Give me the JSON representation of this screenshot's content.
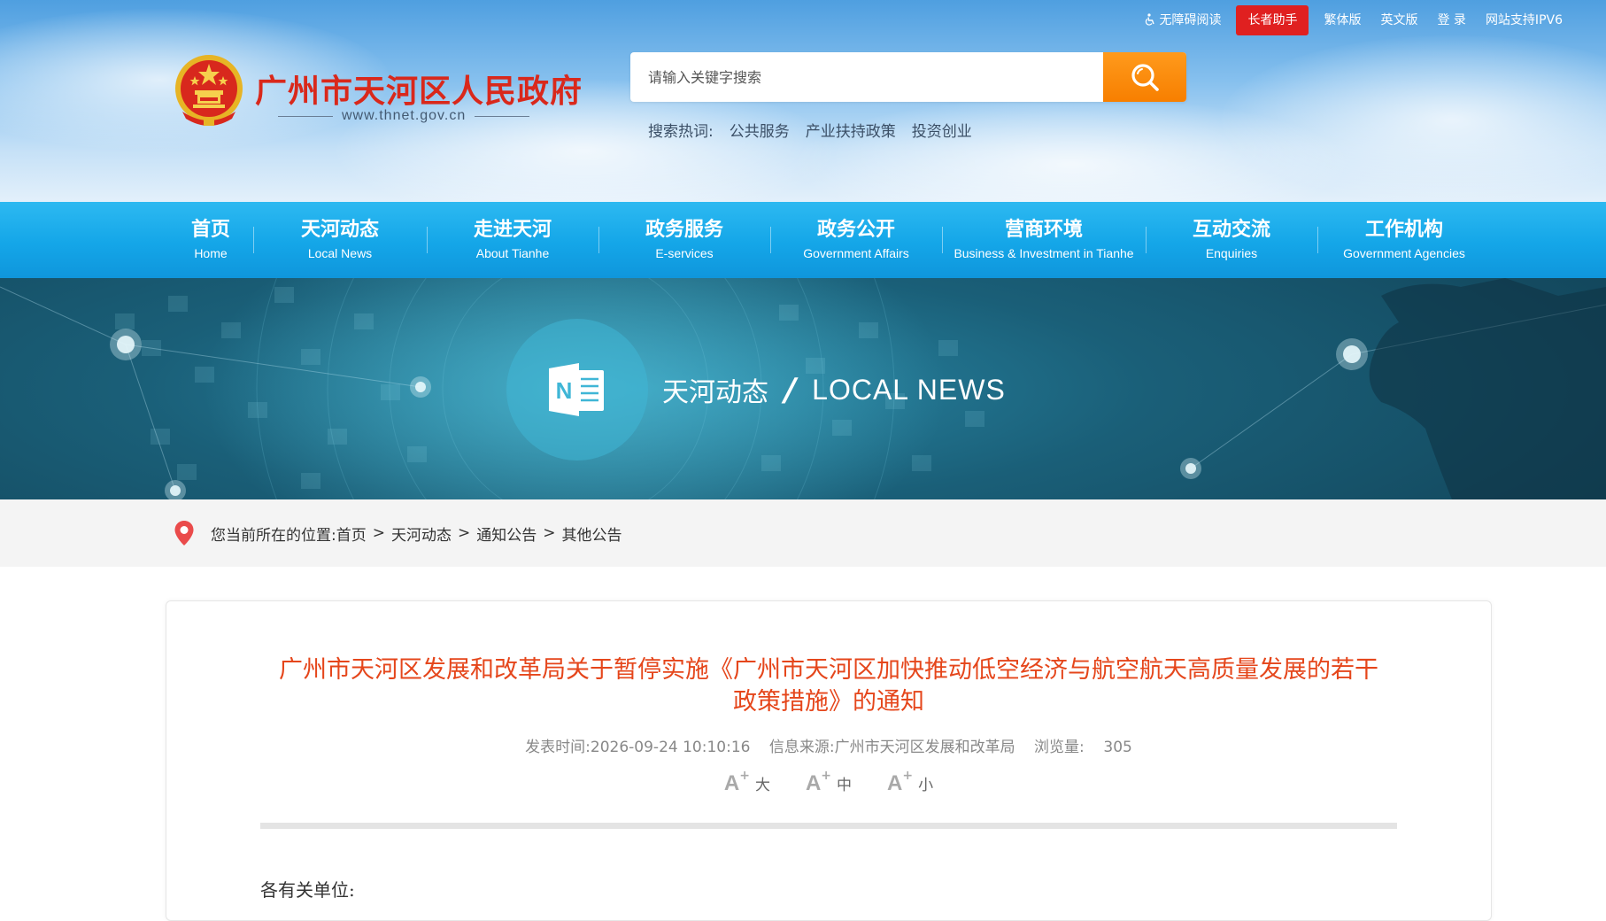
{
  "top_links": {
    "accessibility": "无障碍阅读",
    "elder": "长者助手",
    "traditional": "繁体版",
    "english": "英文版",
    "login": "登 录",
    "ipv6": "网站支持IPV6"
  },
  "site": {
    "name": "广州市天河区人民政府",
    "domain": "www.thnet.gov.cn"
  },
  "search": {
    "placeholder": "请输入关键字搜索",
    "hot_label": "搜索热词:",
    "hot_words": [
      "公共服务",
      "产业扶持政策",
      "投资创业"
    ]
  },
  "nav": [
    {
      "cn": "首页",
      "en": "Home"
    },
    {
      "cn": "天河动态",
      "en": "Local News"
    },
    {
      "cn": "走进天河",
      "en": "About Tianhe"
    },
    {
      "cn": "政务服务",
      "en": "E-services"
    },
    {
      "cn": "政务公开",
      "en": "Government Affairs"
    },
    {
      "cn": "营商环境",
      "en": "Business & Investment in Tianhe"
    },
    {
      "cn": "互动交流",
      "en": "Enquiries"
    },
    {
      "cn": "工作机构",
      "en": "Government Agencies"
    }
  ],
  "banner": {
    "cn": "天河动态",
    "slash": "/",
    "en": "LOCAL NEWS",
    "icon_letter": "N"
  },
  "breadcrumb": {
    "label": "您当前所在的位置:",
    "items": [
      "首页",
      "天河动态",
      "通知公告",
      "其他公告"
    ],
    "separator": ">"
  },
  "article": {
    "title_line1": "广州市天河区发展和改革局关于暂停实施《广州市天河区加快推动低空经济与航空航天高质量发展的若干",
    "title_line2": "政策措施》的通知",
    "publish_label": "发表时间:",
    "publish_time": "2026-09-24 10:10:16",
    "source_label": "信息来源:",
    "source": "广州市天河区发展和改革局",
    "views_label": "浏览量:",
    "views": "305",
    "font_sizes": {
      "a": "A",
      "plus": "+",
      "large": "大",
      "medium": "中",
      "small": "小"
    },
    "salutation": "各有关单位:"
  },
  "colors": {
    "nav_blue": "#14a6e8",
    "title_red": "#e5461b",
    "site_red": "#d9281b",
    "search_orange": "#f77f00",
    "elder_red": "#e02020"
  }
}
